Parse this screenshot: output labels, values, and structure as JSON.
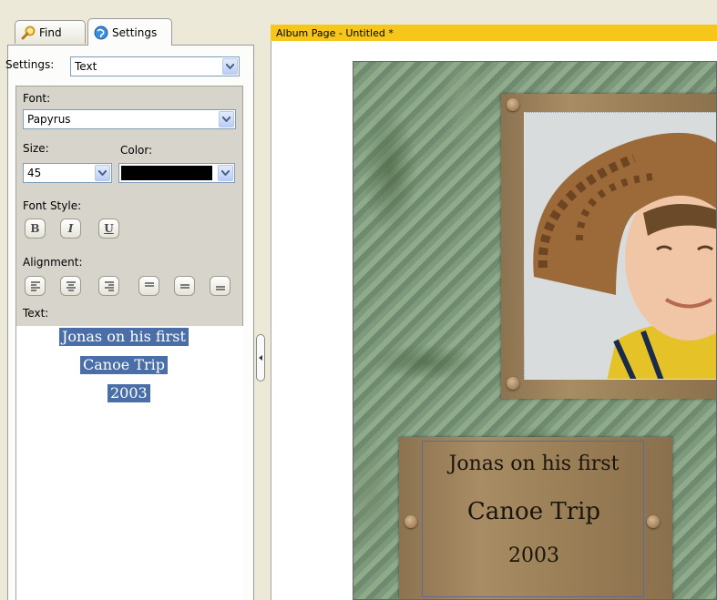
{
  "tabs": [
    {
      "label": "Find",
      "icon": "magnifier-icon"
    },
    {
      "label": "Settings",
      "icon": "settings-globe-icon"
    }
  ],
  "settings": {
    "label": "Settings:",
    "value": "Text"
  },
  "font": {
    "label": "Font:",
    "value": "Papyrus"
  },
  "size": {
    "label": "Size:",
    "value": "45"
  },
  "color": {
    "label": "Color:",
    "value": "#000000"
  },
  "font_style": {
    "label": "Font Style:",
    "bold": "B",
    "italic": "I",
    "underline": "U"
  },
  "alignment": {
    "label": "Alignment:"
  },
  "text": {
    "label": "Text:",
    "lines": [
      "Jonas on his first",
      "Canoe Trip",
      "2003"
    ]
  },
  "document": {
    "title": "Album Page - Untitled *"
  },
  "caption": {
    "lines": [
      "Jonas on his first",
      "Canoe Trip",
      "2003"
    ]
  }
}
